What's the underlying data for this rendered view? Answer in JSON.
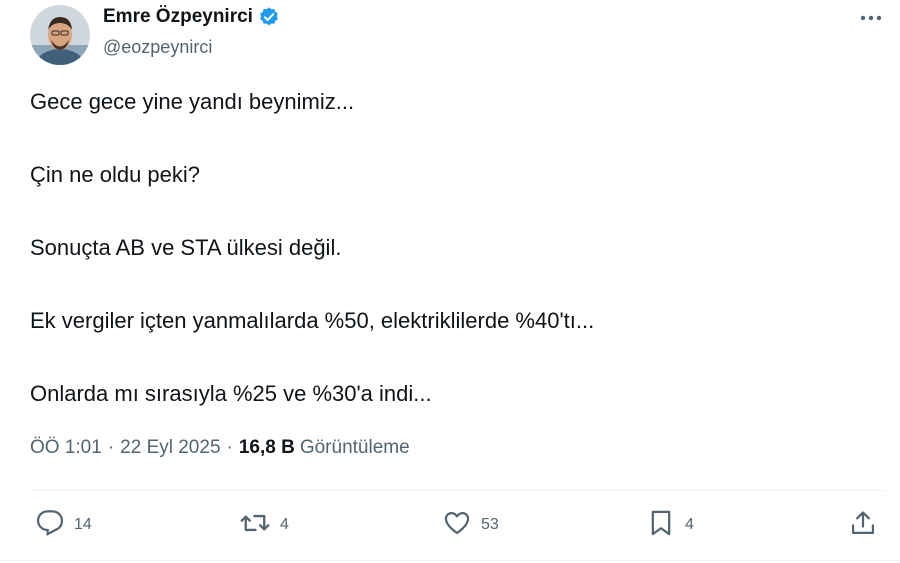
{
  "author": {
    "name": "Emre Özpeynirci",
    "handle": "@eozpeynirci",
    "verified": true
  },
  "tweet": {
    "lines": [
      "Gece gece yine yandı beynimiz...",
      "Çin ne oldu peki?",
      "Sonuçta AB ve STA ülkesi değil.",
      "Ek vergiler içten yanmalılarda %50, elektriklilerde %40'tı...",
      "Onlarda mı sırasıyla %25 ve %30'a indi..."
    ]
  },
  "meta": {
    "time": "ÖÖ 1:01",
    "date": "22 Eyl 2025",
    "separator": "·",
    "views_count": "16,8 B",
    "views_label": "Görüntüleme"
  },
  "actions": {
    "replies": "14",
    "retweets": "4",
    "likes": "53",
    "bookmarks": "4"
  },
  "icons": {
    "more": "more-icon",
    "verified": "verified-badge-icon",
    "reply": "reply-icon",
    "retweet": "retweet-icon",
    "like": "heart-icon",
    "bookmark": "bookmark-icon",
    "share": "share-icon"
  },
  "colors": {
    "text": "#0f1419",
    "secondary": "#536471",
    "verified": "#1d9bf0",
    "divider": "#eff3f4"
  }
}
